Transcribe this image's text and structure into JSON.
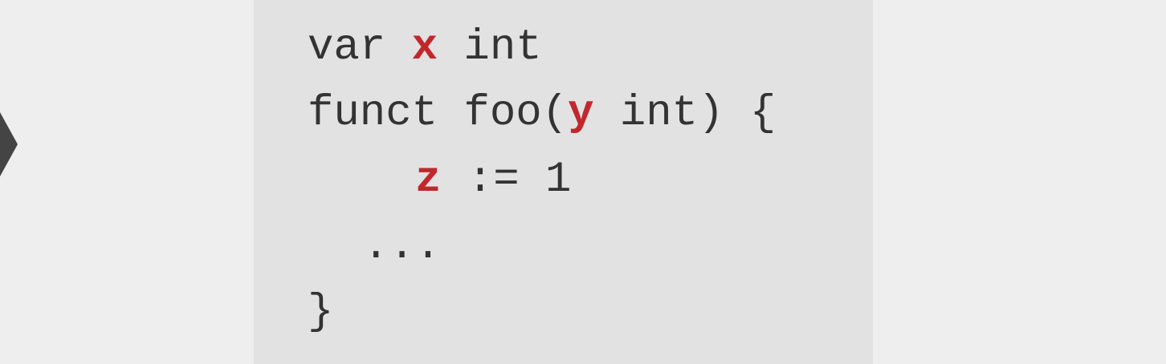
{
  "code": {
    "line1": {
      "kw": "var ",
      "var": "x",
      "rest": " int"
    },
    "line2": {
      "prefix": "funct foo(",
      "var": "y",
      "rest": " int) {"
    },
    "line3": {
      "var": "z",
      "rest": " := 1"
    },
    "line4": {
      "text": "..."
    },
    "line5": {
      "text": "}"
    }
  },
  "colors": {
    "highlight": "#c0282d",
    "code_text": "#333333",
    "panel_bg": "#e2e2e2",
    "page_bg": "#eeeeee"
  },
  "icons": {
    "left": "arrow-left-icon"
  }
}
